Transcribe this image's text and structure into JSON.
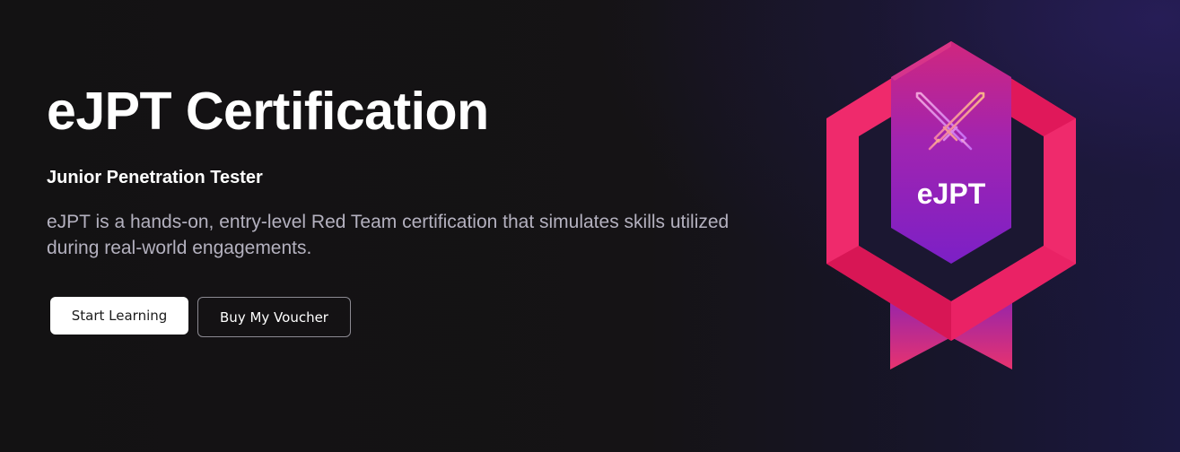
{
  "hero": {
    "title": "eJPT Certification",
    "subtitle": "Junior Penetration Tester",
    "description": "eJPT is a hands-on, entry-level Red Team certification that simulates skills utilized during real-world engagements.",
    "primary_button_label": "Start Learning",
    "secondary_button_label": "Buy My Voucher"
  },
  "badge": {
    "label": "eJPT",
    "icon": "crossed-swords-icon"
  },
  "colors": {
    "background": "#141214",
    "accent_pink": "#ee2a6b",
    "accent_purple": "#8a22c8",
    "text_primary": "#ffffff",
    "text_secondary": "#b4b1bf"
  }
}
